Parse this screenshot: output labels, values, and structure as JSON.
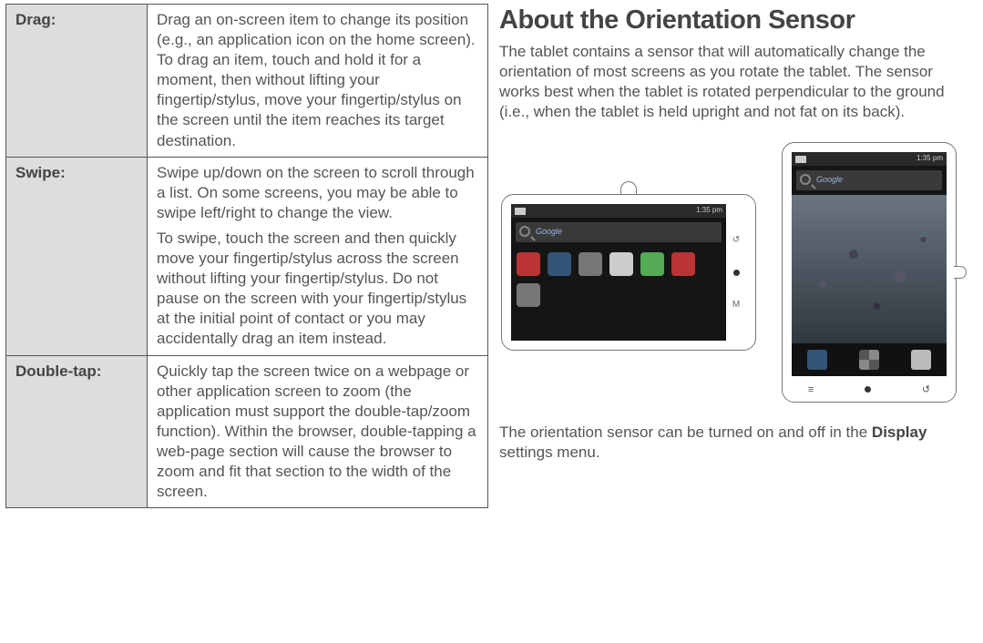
{
  "table": {
    "rows": [
      {
        "term": "Drag:",
        "paras": [
          "Drag an on-screen item to change its position (e.g., an application icon on the home screen).\nTo drag an item, touch and hold it for a moment, then without lifting your fingertip/stylus, move your fingertip/stylus on the screen until the item reaches its target destination."
        ]
      },
      {
        "term": "Swipe:",
        "paras": [
          "Swipe up/down on the screen to scroll through a list. On some screens, you may be able to swipe left/right to change the view.",
          "To swipe, touch the screen and then quickly move your fingertip/stylus across the screen without lifting your fingertip/stylus. Do not pause on the screen with your fingertip/stylus at the initial point of contact or you may accidentally drag an item instead."
        ]
      },
      {
        "term": "Double-tap:",
        "paras": [
          "Quickly tap the screen twice on a webpage or other application screen to zoom (the application must support the double-tap/zoom function). Within the browser, double-tapping a web-page section will cause the browser to zoom and fit that section to the width of the screen."
        ]
      }
    ]
  },
  "right": {
    "heading": "About the Orientation Sensor",
    "intro": "The tablet contains a sensor that will automatically change the orientation of most screens as you rotate the tablet. The sensor works best when the tablet is rotated perpendicular to the ground (i.e., when the tablet is held upright and not fat on its back).",
    "outro_pre": "The orientation sensor can be turned on and off in the ",
    "outro_bold": "Display",
    "outro_post": " settings menu."
  },
  "device": {
    "time": "1:35 pm",
    "sidebar_back": "↺",
    "sidebar_menu": "M",
    "pt_nav_back": "↺",
    "pt_nav_menu": "≡"
  }
}
